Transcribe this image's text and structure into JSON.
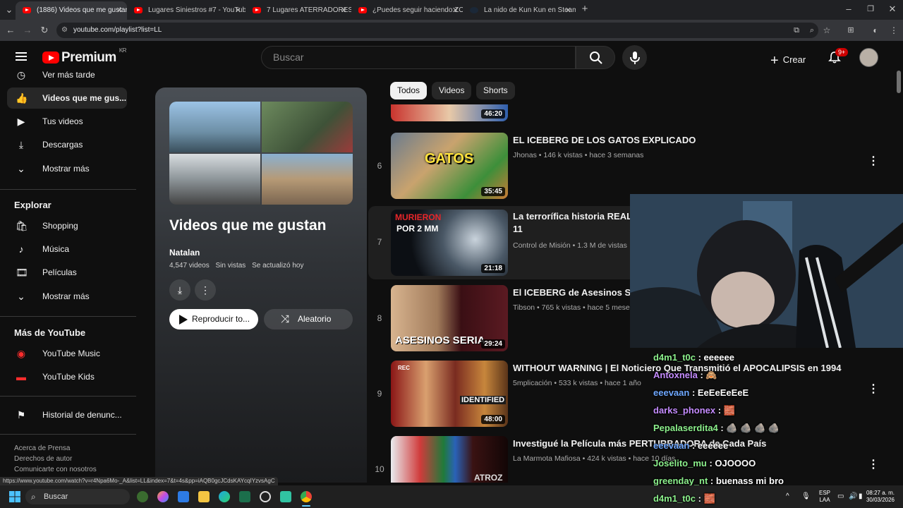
{
  "browser": {
    "tabs": [
      {
        "label": "(1886) Videos que me gustan -",
        "active": true,
        "icon": "youtube"
      },
      {
        "label": "Lugares Siniestros #7 - YouTub",
        "active": false,
        "icon": "youtube"
      },
      {
        "label": "7 Lugares ATERRADORES en LA",
        "active": false,
        "icon": "youtube"
      },
      {
        "label": "¿Puedes seguir haciendo ZOOM",
        "active": false,
        "icon": "youtube"
      },
      {
        "label": "La nido de Kun Kun en Steam",
        "active": false,
        "icon": "steam"
      }
    ],
    "url": "youtube.com/playlist?list=LL",
    "new_tab": "+"
  },
  "header": {
    "brand": "Premium",
    "region": "KR",
    "search_placeholder": "Buscar",
    "create_label": "Crear",
    "notif_badge": "9+"
  },
  "sidebar": {
    "items_top": [
      {
        "label": "Ver más tarde",
        "icon": "clock-icon"
      },
      {
        "label": "Videos que me gus...",
        "icon": "thumbs-up-icon",
        "selected": true
      },
      {
        "label": "Tus videos",
        "icon": "video-icon"
      },
      {
        "label": "Descargas",
        "icon": "download-icon"
      },
      {
        "label": "Mostrar más",
        "icon": "chevron-down-icon"
      }
    ],
    "explore_heading": "Explorar",
    "explore_items": [
      {
        "label": "Shopping",
        "icon": "shopping-bag-icon"
      },
      {
        "label": "Música",
        "icon": "music-note-icon"
      },
      {
        "label": "Películas",
        "icon": "film-icon"
      },
      {
        "label": "Mostrar más",
        "icon": "chevron-down-icon"
      }
    ],
    "more_heading": "Más de YouTube",
    "more_items": [
      {
        "label": "YouTube Music",
        "icon": "youtube-music-icon"
      },
      {
        "label": "YouTube Kids",
        "icon": "youtube-kids-icon"
      }
    ],
    "report_history": "Historial de denunc...",
    "footer_line1": "Acerca de  Prensa",
    "footer_line2": "Derechos de autor",
    "footer_line3": "Comunicarte con nosotros"
  },
  "playlist": {
    "title": "Videos que me gustan",
    "owner": "Natalan",
    "count": "4,547 videos",
    "views": "Sin vistas",
    "updated": "Se actualizó hoy",
    "play_all": "Reproducir to...",
    "shuffle": "Aleatorio"
  },
  "chips": [
    "Todos",
    "Videos",
    "Shorts"
  ],
  "videos": [
    {
      "index": "",
      "title": "",
      "channel": "",
      "views": "",
      "age": "",
      "duration": "46:20"
    },
    {
      "index": "6",
      "title": "EL ICEBERG DE LOS GATOS EXPLICADO",
      "channel": "Jhonas",
      "views": "146 k vistas",
      "age": "hace 3 semanas",
      "duration": "35:45"
    },
    {
      "index": "7",
      "title": "La terrorífica historia REAL c",
      "title2": "11",
      "channel": "Control de Misión",
      "views": "1.3 M de vistas",
      "age": "",
      "duration": "21:18"
    },
    {
      "index": "8",
      "title": "El ICEBERG de Asesinos Ser",
      "channel": "Tibson",
      "views": "765 k vistas",
      "age": "hace 5 meses",
      "duration": "29:24"
    },
    {
      "index": "9",
      "title": "WITHOUT WARNING | El Noticiero Que Transmitió el APOCALIPSIS en 1994",
      "channel": "5mplicación",
      "views": "533 k vistas",
      "age": "hace 1 año",
      "duration": "48:00"
    },
    {
      "index": "10",
      "title": "Investigué la Película más PERTURBADORA de Cada País",
      "channel": "La Marmota Mafiosa",
      "views": "424 k vistas",
      "age": "hace 10 días",
      "duration": ""
    }
  ],
  "thumb_text": {
    "gatos": "GATOS",
    "murieron": "MURIERON",
    "por2mm": "POR 2 MM",
    "asesinos": "ASESINOS SERIA",
    "identified": "IDENTIFIED",
    "rec": "REC",
    "atroz": "ATROZ"
  },
  "chat": [
    {
      "user": "d4m1_t0c",
      "msg": "eeeeee",
      "color": "#8cf08c"
    },
    {
      "user": "Antoxnela",
      "msg": "🙈",
      "color": "#c58cff"
    },
    {
      "user": "eeevaan",
      "msg": "EeEeEeEeE",
      "color": "#6fa8ff"
    },
    {
      "user": "darks_phonex",
      "msg": "🧱",
      "color": "#c58cff"
    },
    {
      "user": "Pepalaserdita4",
      "msg": "🪨 🪨 🪨 🪨",
      "color": "#8cf08c"
    },
    {
      "user": "eeevaan",
      "msg": "eeeeee",
      "color": "#6fa8ff"
    },
    {
      "user": "Joselito_mu",
      "msg": "OJOOOO",
      "color": "#8cf08c"
    },
    {
      "user": "greenday_nt",
      "msg": "buenass mi bro",
      "color": "#8cf08c"
    },
    {
      "user": "d4m1_t0c",
      "msg": "🧱",
      "color": "#8cf08c"
    }
  ],
  "status_url": "https://www.youtube.com/watch?v=r4Npa6Mo-_A&list=LL&index=7&t=4s&pp=iAQB0gcJCdsKAYcqIYzvsAgC",
  "taskbar": {
    "search": "Buscar",
    "lang1": "ESP",
    "lang2": "LAA",
    "time": "08:27 a. m.",
    "date": "30/03/2026"
  }
}
